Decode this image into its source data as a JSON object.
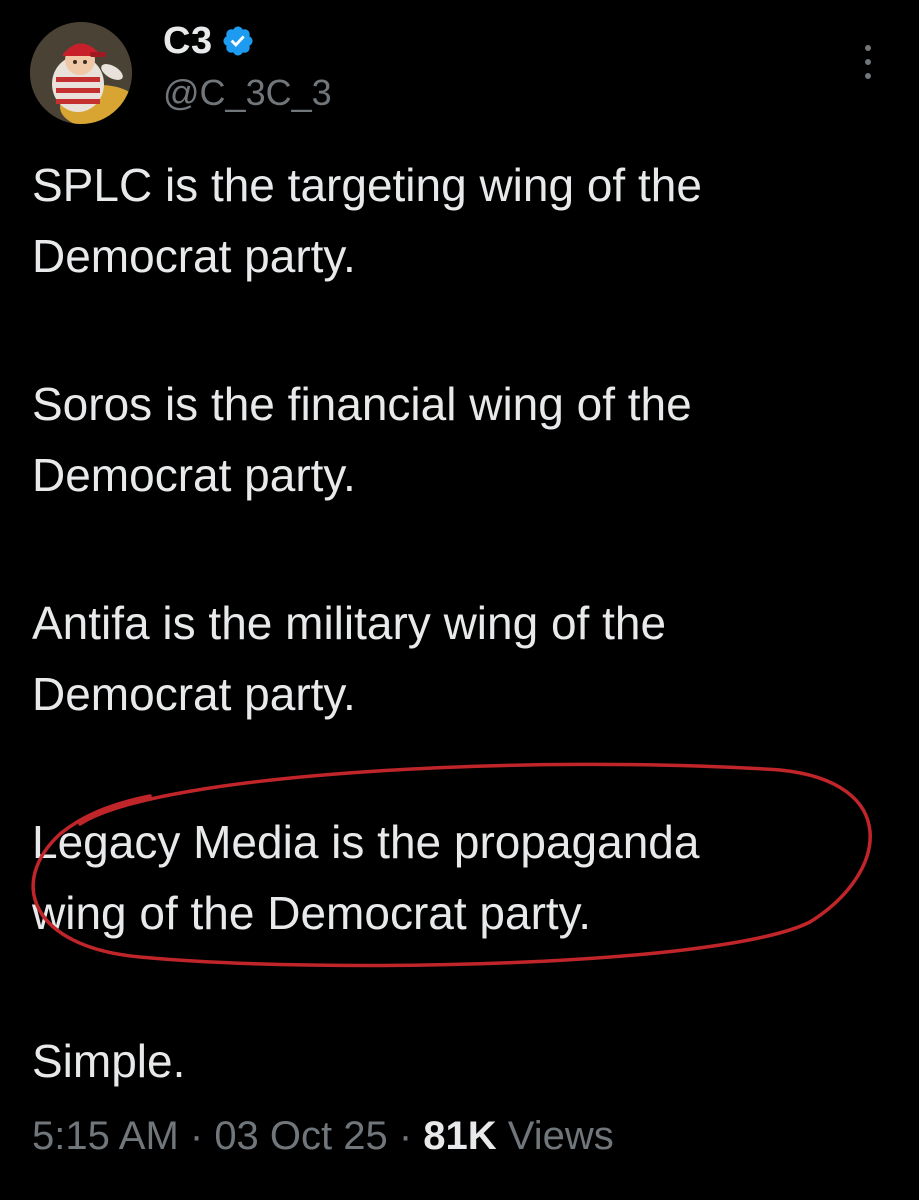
{
  "author": {
    "display_name": "C3",
    "handle": "@C_3C_3",
    "verified": true
  },
  "tweet": {
    "paragraphs": [
      "SPLC is the targeting wing of the\nDemocrat party.",
      "Soros is the financial wing of the\nDemocrat party.",
      "Antifa is the military wing of the\nDemocrat party.",
      "Legacy Media is the propaganda\nwing of the Democrat party.",
      "Simple."
    ]
  },
  "meta": {
    "time": "5:15 AM",
    "separator": " · ",
    "date": "03 Oct 25",
    "views_count": "81K",
    "views_label": " Views"
  },
  "icons": {
    "verified": "verified-badge-icon",
    "more": "more-vertical-icon"
  },
  "colors": {
    "background": "#000000",
    "text": "#e7e9ea",
    "muted": "#71767b",
    "verified": "#1d9bf0",
    "annotation": "#c0252a"
  }
}
